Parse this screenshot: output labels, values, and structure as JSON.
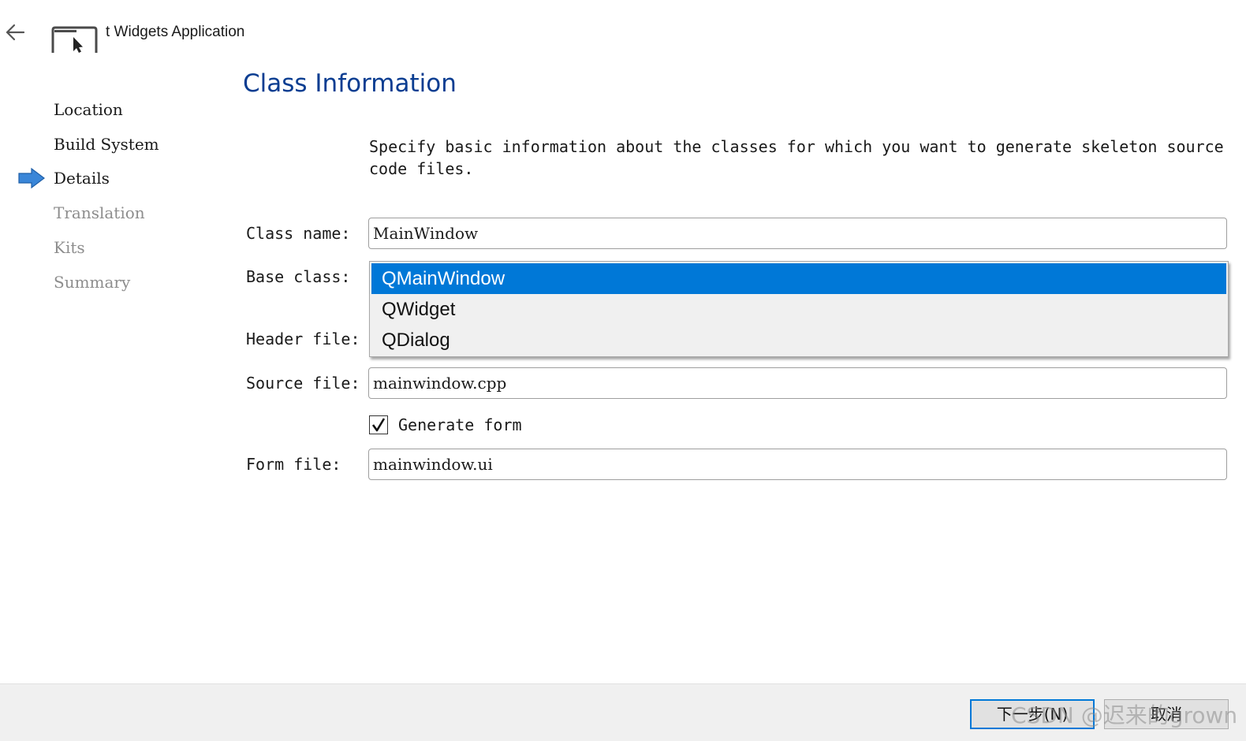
{
  "window": {
    "title": "t Widgets Application"
  },
  "steps": [
    {
      "label": "Location",
      "state": "done"
    },
    {
      "label": "Build System",
      "state": "done"
    },
    {
      "label": "Details",
      "state": "current"
    },
    {
      "label": "Translation",
      "state": "pending"
    },
    {
      "label": "Kits",
      "state": "pending"
    },
    {
      "label": "Summary",
      "state": "pending"
    }
  ],
  "page": {
    "title": "Class Information",
    "description": "Specify basic information about the classes for which you want to generate skeleton source code files."
  },
  "form": {
    "class_name_label": "Class name:",
    "class_name_value": "MainWindow",
    "base_class_label": "Base class:",
    "base_class_options": [
      "QMainWindow",
      "QWidget",
      "QDialog"
    ],
    "base_class_selected": "QMainWindow",
    "header_file_label": "Header file:",
    "source_file_label": "Source file:",
    "source_file_value": "mainwindow.cpp",
    "generate_form_label": "Generate form",
    "generate_form_checked": true,
    "form_file_label": "Form file:",
    "form_file_value": "mainwindow.ui"
  },
  "footer": {
    "next_label": "下一步(N)",
    "cancel_label": "取消",
    "watermark": "CSDN @迟来的grown"
  },
  "colors": {
    "accent": "#0078d7",
    "title": "#0a3d91",
    "step_arrow": "#3a86d8"
  }
}
